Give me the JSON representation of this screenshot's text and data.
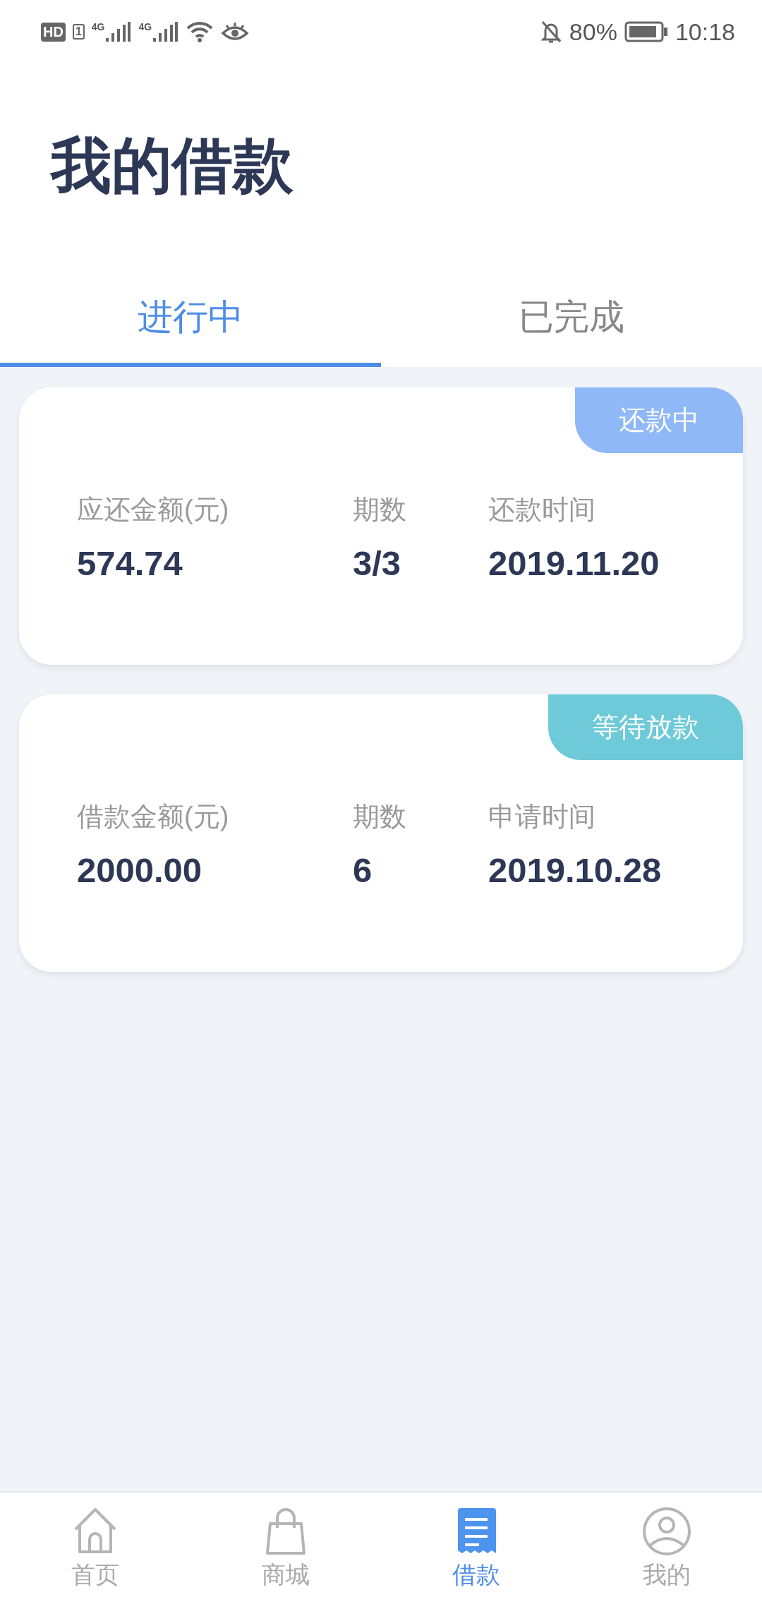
{
  "status_bar": {
    "hd": "HD",
    "sim": "1",
    "networks": [
      "4G",
      "4G"
    ],
    "battery": "80%",
    "time": "10:18"
  },
  "title": "我的借款",
  "tabs": [
    {
      "label": "进行中",
      "selected": true
    },
    {
      "label": "已完成",
      "selected": false
    }
  ],
  "loans": [
    {
      "status": "还款中",
      "color": "#8fb8f6",
      "fields": [
        {
          "label": "应还金额(元)",
          "value": "574.74"
        },
        {
          "label": "期数",
          "value": "3/3"
        },
        {
          "label": "还款时间",
          "value": "2019.11.20"
        }
      ]
    },
    {
      "status": "等待放款",
      "color": "#6ecad8",
      "fields": [
        {
          "label": "借款金额(元)",
          "value": "2000.00"
        },
        {
          "label": "期数",
          "value": "6"
        },
        {
          "label": "申请时间",
          "value": "2019.10.28"
        }
      ]
    }
  ],
  "nav": [
    {
      "kind": "home",
      "label": "首页",
      "selected": false
    },
    {
      "kind": "shop",
      "label": "商城",
      "selected": false
    },
    {
      "kind": "loan",
      "label": "借款",
      "selected": true
    },
    {
      "kind": "profile",
      "label": "我的",
      "selected": false
    }
  ]
}
